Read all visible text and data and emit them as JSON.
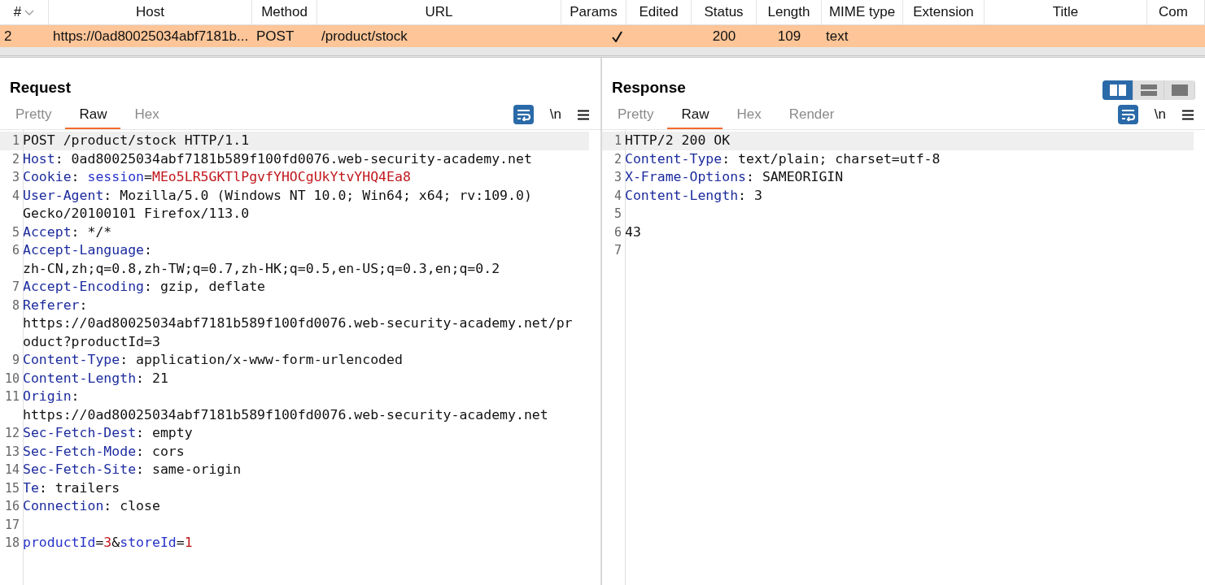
{
  "table": {
    "columns": [
      {
        "label": "#",
        "sorted": true
      },
      {
        "label": "Host"
      },
      {
        "label": "Method"
      },
      {
        "label": "URL"
      },
      {
        "label": "Params"
      },
      {
        "label": "Edited"
      },
      {
        "label": "Status"
      },
      {
        "label": "Length"
      },
      {
        "label": "MIME type"
      },
      {
        "label": "Extension"
      },
      {
        "label": "Title"
      },
      {
        "label": "Com"
      }
    ],
    "rows": [
      {
        "selected": true,
        "number": "2",
        "host": "https://0ad80025034abf7181b...",
        "method": "POST",
        "url": "/product/stock",
        "params": true,
        "status": "200",
        "length": "109",
        "mime_type": "text"
      }
    ]
  },
  "request": {
    "title": "Request",
    "tabs": [
      {
        "label": "Pretty",
        "selected": false
      },
      {
        "label": "Raw",
        "selected": true
      },
      {
        "label": "Hex",
        "selected": false
      }
    ],
    "wrap": true,
    "newline_toggle": "\\n",
    "lines": [
      {
        "number": "1",
        "current": true,
        "rows": [
          [
            {
              "kind": "text",
              "text": "POST /product/stock HTTP/1.1"
            }
          ]
        ]
      },
      {
        "number": "2",
        "current": false,
        "rows": [
          [
            {
              "kind": "key",
              "text": "Host"
            },
            {
              "kind": "text",
              "text": ": 0ad80025034abf7181b589f100fd0076.web-security-academy.net"
            }
          ]
        ]
      },
      {
        "number": "3",
        "current": false,
        "rows": [
          [
            {
              "kind": "key",
              "text": "Cookie"
            },
            {
              "kind": "text",
              "text": ": "
            },
            {
              "kind": "param",
              "text": "session"
            },
            {
              "kind": "text",
              "text": "="
            },
            {
              "kind": "value",
              "text": "MEo5LR5GKTlPgvfYHOCgUkYtvYHQ4Ea8"
            }
          ]
        ]
      },
      {
        "number": "4",
        "current": false,
        "rows": [
          [
            {
              "kind": "key",
              "text": "User-Agent"
            },
            {
              "kind": "text",
              "text": ": Mozilla/5.0 (Windows NT 10.0; Win64; x64; rv:109.0)"
            }
          ],
          [
            {
              "kind": "text",
              "text": "Gecko/20100101 Firefox/113.0"
            }
          ]
        ]
      },
      {
        "number": "5",
        "current": false,
        "rows": [
          [
            {
              "kind": "key",
              "text": "Accept"
            },
            {
              "kind": "text",
              "text": ": */*"
            }
          ]
        ]
      },
      {
        "number": "6",
        "current": false,
        "rows": [
          [
            {
              "kind": "key",
              "text": "Accept-Language"
            },
            {
              "kind": "text",
              "text": ":"
            }
          ],
          [
            {
              "kind": "text",
              "text": "zh-CN,zh;q=0.8,zh-TW;q=0.7,zh-HK;q=0.5,en-US;q=0.3,en;q=0.2"
            }
          ]
        ]
      },
      {
        "number": "7",
        "current": false,
        "rows": [
          [
            {
              "kind": "key",
              "text": "Accept-Encoding"
            },
            {
              "kind": "text",
              "text": ": gzip, deflate"
            }
          ]
        ]
      },
      {
        "number": "8",
        "current": false,
        "rows": [
          [
            {
              "kind": "key",
              "text": "Referer"
            },
            {
              "kind": "text",
              "text": ":"
            }
          ],
          [
            {
              "kind": "text",
              "text": "https://0ad80025034abf7181b589f100fd0076.web-security-academy.net/pr"
            }
          ],
          [
            {
              "kind": "text",
              "text": "oduct?productId=3"
            }
          ]
        ]
      },
      {
        "number": "9",
        "current": false,
        "rows": [
          [
            {
              "kind": "key",
              "text": "Content-Type"
            },
            {
              "kind": "text",
              "text": ": application/x-www-form-urlencoded"
            }
          ]
        ]
      },
      {
        "number": "10",
        "current": false,
        "rows": [
          [
            {
              "kind": "key",
              "text": "Content-Length"
            },
            {
              "kind": "text",
              "text": ": 21"
            }
          ]
        ]
      },
      {
        "number": "11",
        "current": false,
        "rows": [
          [
            {
              "kind": "key",
              "text": "Origin"
            },
            {
              "kind": "text",
              "text": ":"
            }
          ],
          [
            {
              "kind": "text",
              "text": "https://0ad80025034abf7181b589f100fd0076.web-security-academy.net"
            }
          ]
        ]
      },
      {
        "number": "12",
        "current": false,
        "rows": [
          [
            {
              "kind": "key",
              "text": "Sec-Fetch-Dest"
            },
            {
              "kind": "text",
              "text": ": empty"
            }
          ]
        ]
      },
      {
        "number": "13",
        "current": false,
        "rows": [
          [
            {
              "kind": "key",
              "text": "Sec-Fetch-Mode"
            },
            {
              "kind": "text",
              "text": ": cors"
            }
          ]
        ]
      },
      {
        "number": "14",
        "current": false,
        "rows": [
          [
            {
              "kind": "key",
              "text": "Sec-Fetch-Site"
            },
            {
              "kind": "text",
              "text": ": same-origin"
            }
          ]
        ]
      },
      {
        "number": "15",
        "current": false,
        "rows": [
          [
            {
              "kind": "key",
              "text": "Te"
            },
            {
              "kind": "text",
              "text": ": trailers"
            }
          ]
        ]
      },
      {
        "number": "16",
        "current": false,
        "rows": [
          [
            {
              "kind": "key",
              "text": "Connection"
            },
            {
              "kind": "text",
              "text": ": close"
            }
          ]
        ]
      },
      {
        "number": "17",
        "current": false
      },
      {
        "number": "18",
        "current": false,
        "rows": [
          [
            {
              "kind": "param",
              "text": "productId"
            },
            {
              "kind": "text",
              "text": "="
            },
            {
              "kind": "value",
              "text": "3"
            },
            {
              "kind": "text",
              "text": "&"
            },
            {
              "kind": "param",
              "text": "storeId"
            },
            {
              "kind": "text",
              "text": "="
            },
            {
              "kind": "value",
              "text": "1"
            }
          ]
        ]
      }
    ]
  },
  "response": {
    "title": "Response",
    "layout_buttons": [
      {
        "selected": true
      },
      {
        "selected": false
      },
      {
        "selected": false
      }
    ],
    "tabs": [
      {
        "label": "Pretty",
        "selected": false
      },
      {
        "label": "Raw",
        "selected": true
      },
      {
        "label": "Hex",
        "selected": false
      },
      {
        "label": "Render",
        "selected": false
      }
    ],
    "wrap": true,
    "newline_toggle": "\\n",
    "lines": [
      {
        "number": "1",
        "current": true,
        "rows": [
          [
            {
              "kind": "text",
              "text": "HTTP/2 200 OK"
            }
          ]
        ]
      },
      {
        "number": "2",
        "current": false,
        "rows": [
          [
            {
              "kind": "key",
              "text": "Content-Type"
            },
            {
              "kind": "text",
              "text": ": text/plain; charset=utf-8"
            }
          ]
        ]
      },
      {
        "number": "3",
        "current": false,
        "rows": [
          [
            {
              "kind": "key",
              "text": "X-Frame-Options"
            },
            {
              "kind": "text",
              "text": ": SAMEORIGIN"
            }
          ]
        ]
      },
      {
        "number": "4",
        "current": false,
        "rows": [
          [
            {
              "kind": "key",
              "text": "Content-Length"
            },
            {
              "kind": "text",
              "text": ": 3"
            }
          ]
        ]
      },
      {
        "number": "5",
        "current": false
      },
      {
        "number": "6",
        "current": false,
        "rows": [
          [
            {
              "kind": "text",
              "text": "43"
            }
          ]
        ]
      },
      {
        "number": "7",
        "current": false
      }
    ]
  }
}
